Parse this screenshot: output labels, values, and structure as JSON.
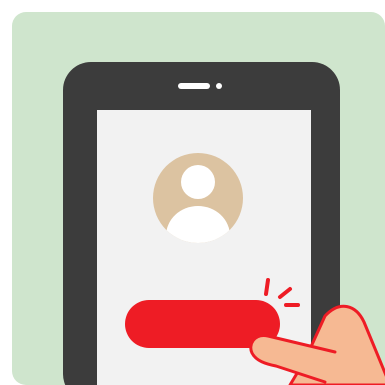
{
  "illustration": {
    "icons": [
      "phone-illustration",
      "avatar-icon",
      "finger-pointer-icon",
      "tap-burst-icon"
    ],
    "colors": {
      "panel": "#cfe5cd",
      "phone_body": "#3c3c3c",
      "screen": "#f2f2f2",
      "avatar_circle": "#dcc3a1",
      "avatar_figure": "#ffffff",
      "button": "#ee1c25",
      "hand": "#f6b993",
      "hand_outline": "#ee1c25",
      "tap_burst": "#ee1c25",
      "speaker": "#ffffff"
    }
  }
}
